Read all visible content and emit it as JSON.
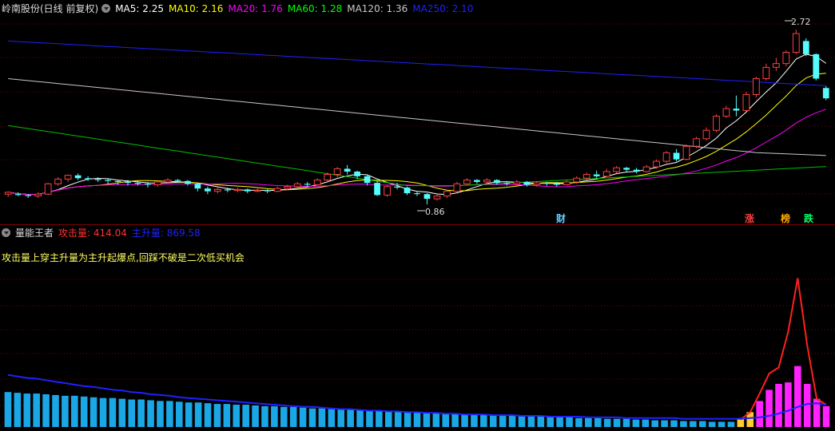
{
  "main_legend": {
    "title": "岭南股份(日线 前复权)",
    "items": [
      {
        "label": "MA5: 2.25",
        "color": "#ffffff"
      },
      {
        "label": "MA10: 2.16",
        "color": "#ffff00"
      },
      {
        "label": "MA20: 1.76",
        "color": "#ff00ff"
      },
      {
        "label": "MA60: 1.28",
        "color": "#00ff00"
      },
      {
        "label": "MA120: 1.36",
        "color": "#c8c8c8"
      },
      {
        "label": "MA250: 2.10",
        "color": "#2020ff"
      }
    ]
  },
  "sub_legend": {
    "title": "量能王者",
    "items": [
      {
        "label": "攻击量: 414.04",
        "color": "#ff3030"
      },
      {
        "label": "主升量: 869.58",
        "color": "#2020ff"
      }
    ]
  },
  "note": "攻击量上穿主升量为主升起爆点,回踩不破是二次低买机会",
  "price_labels": {
    "high": "2.72",
    "low": "0.86"
  },
  "markers": [
    {
      "text": "财",
      "color": "#66ccff"
    },
    {
      "text": "涨",
      "color": "#ff4040"
    },
    {
      "text": "榜",
      "color": "#ffaa00"
    },
    {
      "text": "跌",
      "color": "#00ff66"
    }
  ],
  "colors": {
    "up": "#ff4040",
    "down": "#54fcfc",
    "grid": "#7a0000"
  },
  "chart_data": [
    {
      "type": "candlestick",
      "ylim": [
        0.7,
        2.85
      ],
      "candles": [
        [
          0.97,
          0.99,
          0.94,
          1.0
        ],
        [
          0.97,
          0.96,
          0.95,
          0.99
        ],
        [
          0.96,
          0.95,
          0.93,
          0.97
        ],
        [
          0.95,
          0.97,
          0.93,
          0.99
        ],
        [
          0.97,
          1.08,
          0.96,
          1.09
        ],
        [
          1.08,
          1.13,
          1.06,
          1.15
        ],
        [
          1.13,
          1.17,
          1.1,
          1.18
        ],
        [
          1.17,
          1.14,
          1.12,
          1.19
        ],
        [
          1.14,
          1.13,
          1.11,
          1.16
        ],
        [
          1.13,
          1.12,
          1.1,
          1.15
        ],
        [
          1.12,
          1.11,
          1.08,
          1.14
        ],
        [
          1.11,
          1.1,
          1.07,
          1.12
        ],
        [
          1.1,
          1.09,
          1.06,
          1.12
        ],
        [
          1.09,
          1.08,
          1.06,
          1.11
        ],
        [
          1.08,
          1.07,
          1.04,
          1.1
        ],
        [
          1.07,
          1.1,
          1.05,
          1.12
        ],
        [
          1.1,
          1.12,
          1.08,
          1.14
        ],
        [
          1.12,
          1.11,
          1.09,
          1.13
        ],
        [
          1.11,
          1.08,
          1.06,
          1.12
        ],
        [
          1.08,
          1.03,
          1.0,
          1.09
        ],
        [
          1.03,
          1.0,
          0.97,
          1.05
        ],
        [
          1.0,
          1.02,
          0.98,
          1.04
        ],
        [
          1.02,
          1.01,
          0.99,
          1.04
        ],
        [
          1.01,
          1.02,
          0.99,
          1.04
        ],
        [
          1.02,
          1.0,
          0.98,
          1.03
        ],
        [
          1.0,
          1.01,
          0.99,
          1.03
        ],
        [
          1.01,
          1.0,
          0.98,
          1.03
        ],
        [
          1.0,
          1.03,
          0.99,
          1.05
        ],
        [
          1.03,
          1.05,
          1.01,
          1.07
        ],
        [
          1.05,
          1.08,
          1.03,
          1.1
        ],
        [
          1.08,
          1.07,
          1.05,
          1.1
        ],
        [
          1.07,
          1.12,
          1.06,
          1.14
        ],
        [
          1.12,
          1.18,
          1.1,
          1.2
        ],
        [
          1.18,
          1.24,
          1.15,
          1.26
        ],
        [
          1.24,
          1.21,
          1.18,
          1.28
        ],
        [
          1.21,
          1.16,
          1.13,
          1.22
        ],
        [
          1.16,
          1.09,
          1.06,
          1.17
        ],
        [
          1.09,
          0.96,
          0.95,
          1.11
        ],
        [
          0.96,
          1.05,
          0.94,
          1.07
        ],
        [
          1.05,
          1.04,
          1.02,
          1.09
        ],
        [
          1.04,
          0.98,
          0.96,
          1.05
        ],
        [
          0.98,
          0.97,
          0.95,
          1.0
        ],
        [
          0.97,
          0.92,
          0.86,
          0.98
        ],
        [
          0.92,
          0.95,
          0.9,
          0.97
        ],
        [
          0.95,
          1.0,
          0.93,
          1.01
        ],
        [
          1.0,
          1.08,
          0.99,
          1.1
        ],
        [
          1.08,
          1.12,
          1.06,
          1.14
        ],
        [
          1.12,
          1.1,
          1.08,
          1.13
        ],
        [
          1.1,
          1.12,
          1.08,
          1.14
        ],
        [
          1.12,
          1.09,
          1.07,
          1.13
        ],
        [
          1.09,
          1.08,
          1.06,
          1.11
        ],
        [
          1.08,
          1.1,
          1.06,
          1.12
        ],
        [
          1.1,
          1.07,
          1.05,
          1.11
        ],
        [
          1.07,
          1.09,
          1.05,
          1.11
        ],
        [
          1.09,
          1.08,
          1.06,
          1.1
        ],
        [
          1.08,
          1.07,
          1.05,
          1.1
        ],
        [
          1.07,
          1.1,
          1.06,
          1.12
        ],
        [
          1.1,
          1.14,
          1.08,
          1.16
        ],
        [
          1.14,
          1.18,
          1.12,
          1.2
        ],
        [
          1.18,
          1.16,
          1.14,
          1.22
        ],
        [
          1.16,
          1.21,
          1.15,
          1.24
        ],
        [
          1.21,
          1.25,
          1.19,
          1.27
        ],
        [
          1.25,
          1.23,
          1.2,
          1.26
        ],
        [
          1.23,
          1.21,
          1.19,
          1.25
        ],
        [
          1.21,
          1.26,
          1.2,
          1.28
        ],
        [
          1.26,
          1.32,
          1.24,
          1.34
        ],
        [
          1.32,
          1.41,
          1.3,
          1.43
        ],
        [
          1.41,
          1.34,
          1.32,
          1.45
        ],
        [
          1.34,
          1.48,
          1.33,
          1.5
        ],
        [
          1.48,
          1.56,
          1.46,
          1.58
        ],
        [
          1.56,
          1.65,
          1.54,
          1.68
        ],
        [
          1.65,
          1.8,
          1.63,
          1.82
        ],
        [
          1.8,
          1.88,
          1.78,
          1.91
        ],
        [
          1.88,
          1.86,
          1.8,
          2.02
        ],
        [
          1.86,
          2.03,
          1.85,
          2.06
        ],
        [
          2.03,
          2.2,
          2.0,
          2.22
        ],
        [
          2.2,
          2.32,
          2.18,
          2.36
        ],
        [
          2.32,
          2.36,
          2.28,
          2.42
        ],
        [
          2.36,
          2.48,
          2.33,
          2.5
        ],
        [
          2.48,
          2.68,
          2.46,
          2.72
        ],
        [
          2.6,
          2.46,
          2.44,
          2.63
        ],
        [
          2.46,
          2.2,
          2.18,
          2.47
        ],
        [
          2.1,
          1.99,
          1.97,
          2.12
        ]
      ]
    },
    {
      "type": "bar",
      "ylim": [
        0,
        220
      ],
      "values": [
        47,
        46,
        45,
        45,
        44,
        43,
        42,
        42,
        41,
        40,
        39,
        39,
        38,
        37,
        37,
        36,
        35,
        35,
        34,
        33,
        33,
        32,
        31,
        31,
        30,
        30,
        29,
        28,
        28,
        27,
        27,
        26,
        25,
        25,
        24,
        24,
        23,
        23,
        22,
        22,
        21,
        21,
        20,
        20,
        19,
        19,
        18,
        18,
        17,
        17,
        17,
        16,
        16,
        15,
        15,
        14,
        14,
        14,
        13,
        13,
        12,
        12,
        12,
        11,
        11,
        11,
        10,
        10,
        9,
        9,
        9,
        8,
        8,
        8,
        7,
        7,
        7,
        12,
        20,
        35,
        50,
        58,
        60,
        82,
        58,
        38,
        28
      ],
      "series": [
        {
          "name": "攻击量",
          "values": [
            null,
            null,
            null,
            null,
            null,
            null,
            null,
            null,
            null,
            null,
            null,
            null,
            null,
            null,
            null,
            null,
            null,
            null,
            null,
            null,
            null,
            null,
            null,
            null,
            null,
            null,
            null,
            null,
            null,
            null,
            null,
            null,
            null,
            null,
            null,
            null,
            null,
            null,
            null,
            null,
            null,
            null,
            null,
            null,
            null,
            null,
            null,
            null,
            null,
            null,
            null,
            null,
            null,
            null,
            null,
            null,
            null,
            null,
            null,
            null,
            null,
            null,
            null,
            null,
            null,
            null,
            null,
            null,
            null,
            null,
            null,
            null,
            null,
            null,
            null,
            null,
            null,
            10,
            20,
            45,
            72,
            80,
            128,
            200,
            110,
            38,
            30
          ]
        },
        {
          "name": "主升量",
          "values": [
            70,
            68,
            66,
            65,
            63,
            61,
            59,
            57,
            55,
            54,
            52,
            50,
            49,
            47,
            46,
            44,
            43,
            42,
            40,
            39,
            38,
            37,
            36,
            35,
            34,
            33,
            32,
            31,
            30,
            29,
            28,
            27,
            27,
            26,
            25,
            24,
            24,
            23,
            22,
            22,
            21,
            21,
            20,
            20,
            19,
            19,
            18,
            18,
            17,
            17,
            17,
            16,
            16,
            16,
            15,
            15,
            15,
            14,
            14,
            14,
            14,
            13,
            13,
            13,
            13,
            12,
            12,
            12,
            12,
            12,
            12,
            11,
            11,
            11,
            11,
            11,
            11,
            11,
            12,
            13,
            15,
            18,
            22,
            27,
            31,
            32,
            30
          ]
        }
      ]
    }
  ]
}
